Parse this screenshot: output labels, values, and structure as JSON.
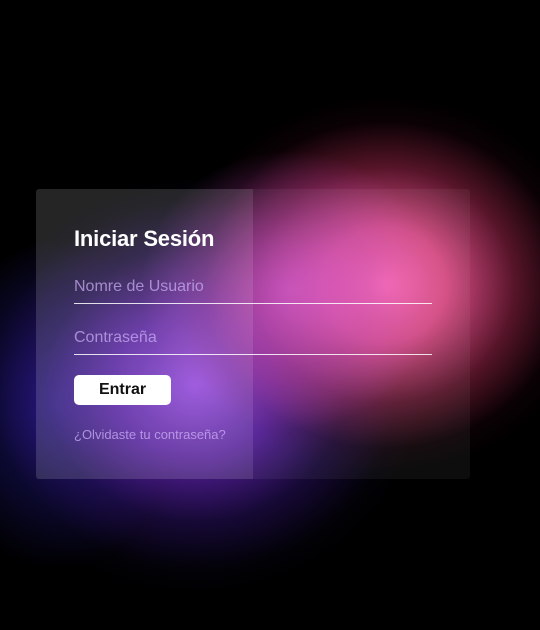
{
  "login": {
    "title": "Iniciar Sesión",
    "username_placeholder": "Nomre de Usuario",
    "username_value": "",
    "password_placeholder": "Contraseña",
    "password_value": "",
    "submit_label": "Entrar",
    "forgot_link": "¿Olvidaste tu contraseña?"
  },
  "colors": {
    "background": "#000000",
    "glow_pink": "#ff69aa",
    "glow_purple": "#9646e6",
    "button_bg": "#ffffff",
    "button_text": "#111111",
    "placeholder_text": "#cdaff5"
  }
}
